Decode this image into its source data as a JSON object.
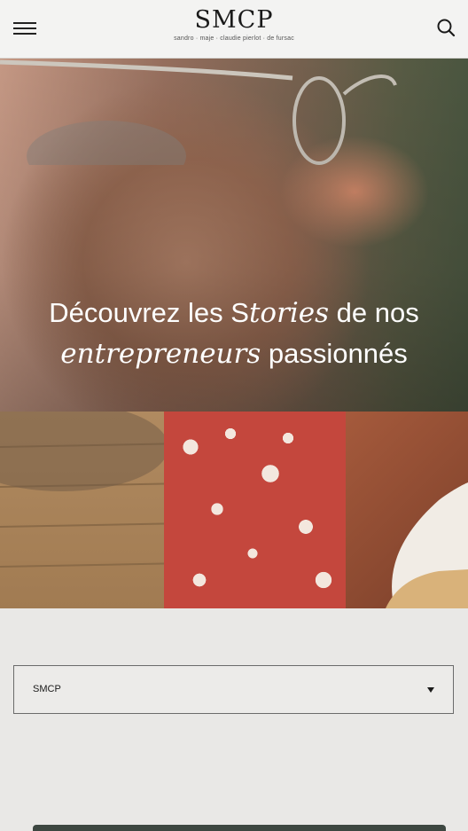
{
  "header": {
    "menu_icon": "hamburger-menu-icon",
    "logo_title": "SMCP",
    "logo_subtitle": "sandro · maje · claudie pierlot · de fursac",
    "search_icon": "search-icon"
  },
  "hero": {
    "title_part1": "Découvrez les S",
    "title_italic1": "tories",
    "title_part2": " de nos",
    "title_italic2": "entrepreneurs",
    "title_part3": " passionnés"
  },
  "filter": {
    "selected": "SMCP",
    "arrow_icon": "caret-down-icon"
  },
  "colors": {
    "header_bg": "#f3f3f2",
    "page_bg": "#e9e8e6",
    "text": "#1b1b1b"
  }
}
